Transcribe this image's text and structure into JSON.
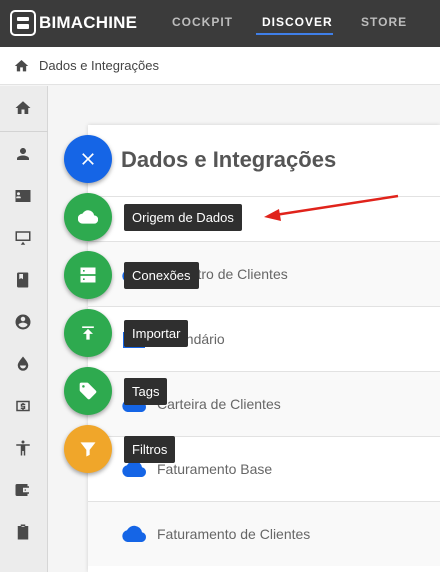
{
  "brand": {
    "name": "BIMACHINE"
  },
  "nav": {
    "items": [
      {
        "label": "COCKPIT"
      },
      {
        "label": "DISCOVER"
      },
      {
        "label": "STORE"
      }
    ],
    "active": "DISCOVER"
  },
  "breadcrumb": {
    "label": "Dados e Integrações"
  },
  "sidebar": {
    "icons": [
      "home-icon",
      "user-icon",
      "contact-card-icon",
      "presentation-icon",
      "book-icon",
      "account-circle-icon",
      "drop-icon",
      "money-icon",
      "accessibility-icon",
      "wallet-icon",
      "clipboard-icon"
    ]
  },
  "panel": {
    "title": "Dados e Integrações",
    "rows": [
      {
        "label": ""
      },
      {
        "label": "Cadastro de Clientes"
      },
      {
        "label": "Calendário"
      },
      {
        "label": "Carteira de Clientes"
      },
      {
        "label": "Faturamento Base"
      },
      {
        "label": "Faturamento de Clientes"
      }
    ]
  },
  "fab_menu": {
    "close_icon": "close-icon",
    "items": [
      {
        "label": "Origem de Dados",
        "icon": "cloud-icon",
        "color": "#2eaa4f"
      },
      {
        "label": "Conexões",
        "icon": "server-icon",
        "color": "#2eaa4f"
      },
      {
        "label": "Importar",
        "icon": "upload-icon",
        "color": "#2eaa4f"
      },
      {
        "label": "Tags",
        "icon": "tag-icon",
        "color": "#2eaa4f"
      },
      {
        "label": "Filtros",
        "icon": "filter-icon",
        "color": "#f0a62a"
      }
    ]
  },
  "colors": {
    "topbar": "#3b3b3b",
    "accent": "#3f7fe8",
    "fab_primary": "#1565e6",
    "cloud_icon": "#1565e6",
    "annotation_arrow": "#e0231b"
  }
}
